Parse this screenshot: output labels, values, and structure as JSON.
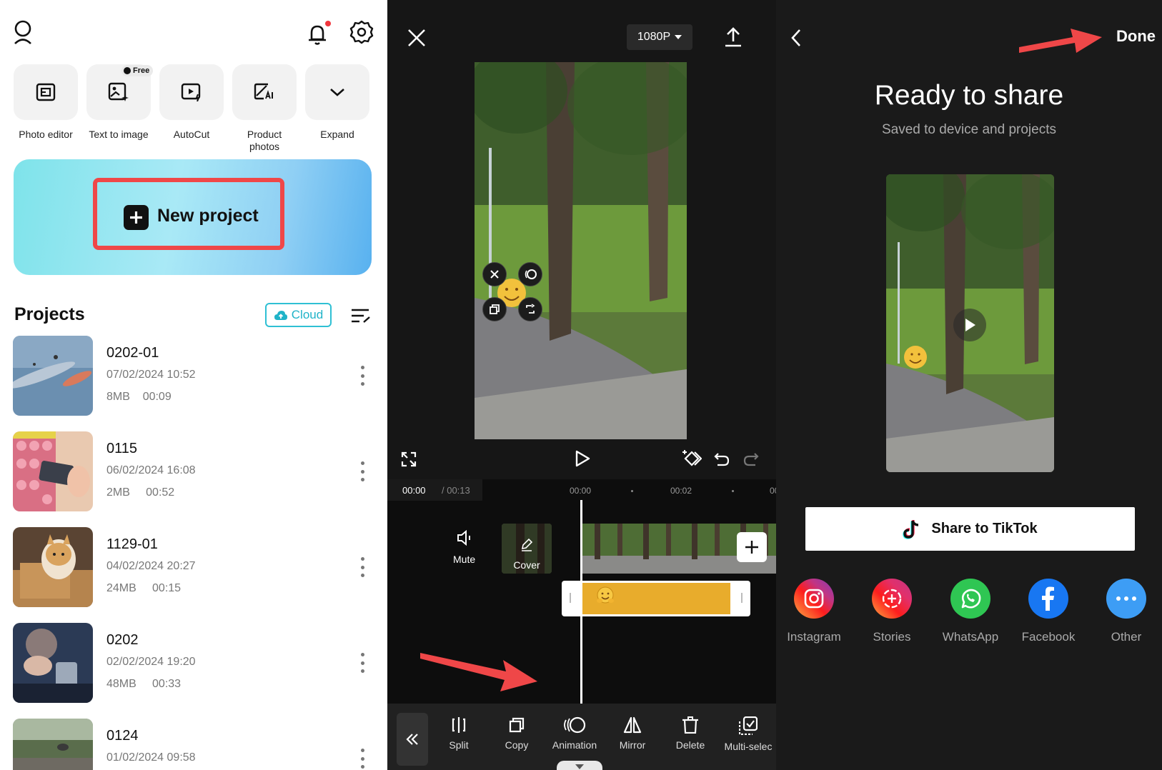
{
  "home": {
    "tools": [
      {
        "label": "Photo editor",
        "icon": "photo-editor-icon"
      },
      {
        "label": "Text to image",
        "icon": "text-to-image-icon",
        "badge": "Free"
      },
      {
        "label": "AutoCut",
        "icon": "autocut-icon"
      },
      {
        "label": "Product\nphotos",
        "icon": "product-photos-icon"
      },
      {
        "label": "Expand",
        "icon": "chevron-down-icon"
      }
    ],
    "new_project_label": "New project",
    "projects_title": "Projects",
    "cloud_label": "Cloud",
    "projects": [
      {
        "name": "0202-01",
        "date": "07/02/2024 10:52",
        "size": "8MB",
        "duration": "00:09"
      },
      {
        "name": "0115",
        "date": "06/02/2024 16:08",
        "size": "2MB",
        "duration": "00:52"
      },
      {
        "name": "1129-01",
        "date": "04/02/2024 20:27",
        "size": "24MB",
        "duration": "00:15"
      },
      {
        "name": "0202",
        "date": "02/02/2024 19:20",
        "size": "48MB",
        "duration": "00:33"
      },
      {
        "name": "0124",
        "date": "01/02/2024 09:58",
        "size": "",
        "duration": ""
      }
    ]
  },
  "editor": {
    "resolution": "1080P",
    "time_current": "00:00",
    "time_total": "/ 00:13",
    "ticks": [
      "00:00",
      "00:02",
      "00"
    ],
    "mute_label": "Mute",
    "cover_label": "Cover",
    "toolbar": [
      {
        "label": "Split",
        "icon": "split-icon"
      },
      {
        "label": "Copy",
        "icon": "copy-icon"
      },
      {
        "label": "Animation",
        "icon": "animation-icon"
      },
      {
        "label": "Mirror",
        "icon": "mirror-icon"
      },
      {
        "label": "Delete",
        "icon": "delete-icon"
      },
      {
        "label": "Multi-selec",
        "icon": "multi-select-icon"
      }
    ]
  },
  "share": {
    "done_label": "Done",
    "title": "Ready to share",
    "subtitle": "Saved to device and projects",
    "tiktok_label": "Share to TikTok",
    "targets": [
      {
        "label": "Instagram",
        "icon": "instagram-icon"
      },
      {
        "label": "Stories",
        "icon": "stories-icon"
      },
      {
        "label": "WhatsApp",
        "icon": "whatsapp-icon"
      },
      {
        "label": "Facebook",
        "icon": "facebook-icon"
      },
      {
        "label": "Other",
        "icon": "more-icon"
      }
    ]
  },
  "colors": {
    "highlight_red": "#ef4748",
    "cloud_teal": "#1fb3c8",
    "sticker_track": "#e8ac2c",
    "notification_dot": "#f0353c"
  }
}
